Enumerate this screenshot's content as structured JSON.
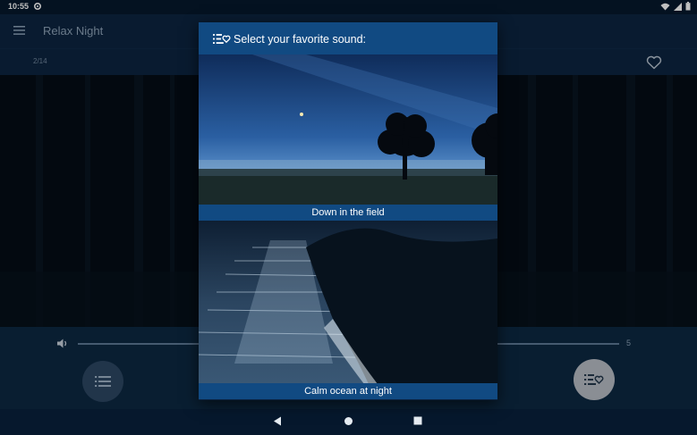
{
  "status_bar": {
    "time": "10:55",
    "icons": [
      "settings-icon",
      "wifi-icon",
      "signal-icon",
      "battery-icon"
    ]
  },
  "toolbar": {
    "title": "Relax Night",
    "menu_icon": "menu-icon"
  },
  "subbar": {
    "counter": "2/14",
    "favorite_icon": "heart-outline-icon"
  },
  "controls": {
    "volume_icon": "volume-icon",
    "volume_value": "5",
    "left_button_icon": "list-icon",
    "right_button_icon": "favorite-list-icon"
  },
  "dialog": {
    "title": "Select your favorite sound:",
    "icon": "favorite-list-icon",
    "items": [
      {
        "label": "Down in the field"
      },
      {
        "label": "Calm ocean at night"
      }
    ]
  },
  "navbar": {
    "buttons": [
      "back-icon",
      "home-icon",
      "recents-icon"
    ]
  },
  "colors": {
    "header_blue": "#114a82",
    "toolbar": "#0c2540",
    "background": "#07182c"
  }
}
